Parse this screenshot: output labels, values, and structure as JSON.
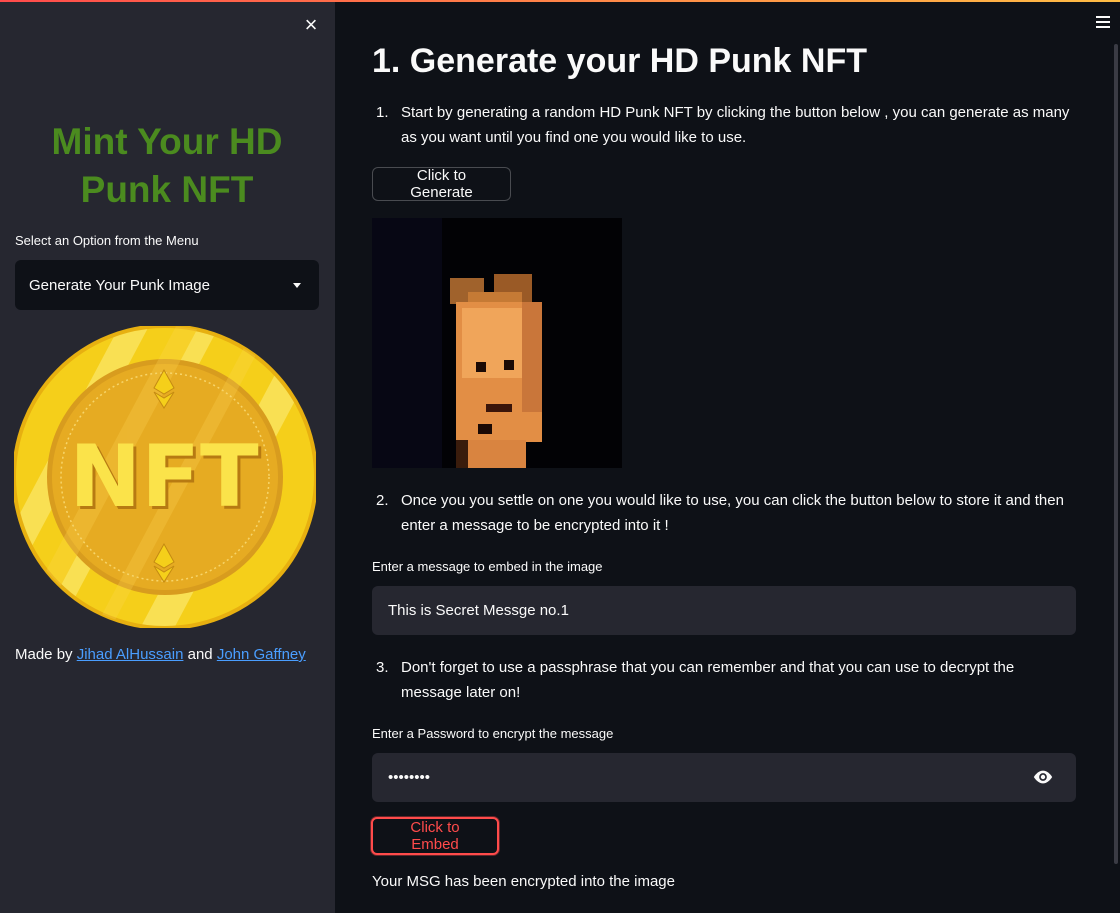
{
  "sidebar": {
    "close_label": "×",
    "title_line1": "Mint Your HD",
    "title_line2": "Punk NFT",
    "select_label": "Select an Option from the Menu",
    "select_value": "Generate Your Punk Image",
    "coin_text": "NFT",
    "made_by_prefix": "Made by ",
    "author1": "Jihad AlHussain",
    "made_by_and": " and ",
    "author2": "John Gaffney"
  },
  "main": {
    "title": "1. Generate your HD Punk NFT",
    "steps": [
      {
        "num": "1.",
        "text": "Start by generating a random HD Punk NFT by clicking the button below , you can generate as many as you want until you find one you would like to use."
      },
      {
        "num": "2.",
        "text": "Once you you settle on one you would like to use, you can click the button below to store it and then enter a message to be encrypted into it !"
      },
      {
        "num": "3.",
        "text": "Don't forget to use a passphrase that you can remember and that you can use to decrypt the message later on!"
      }
    ],
    "generate_button": "Click to Generate",
    "message_label": "Enter a message to embed in the image",
    "message_value": "This is Secret Messge no.1",
    "password_label": "Enter a Password to encrypt the message",
    "password_value": "••••••••",
    "embed_button": "Click to Embed",
    "status": "Your MSG has been encrypted into the image"
  },
  "colors": {
    "accent_red": "#ff4b4b",
    "title_green": "#4b8b1f",
    "link_blue": "#4a9eff",
    "coin_gold": "#f6d21e"
  }
}
